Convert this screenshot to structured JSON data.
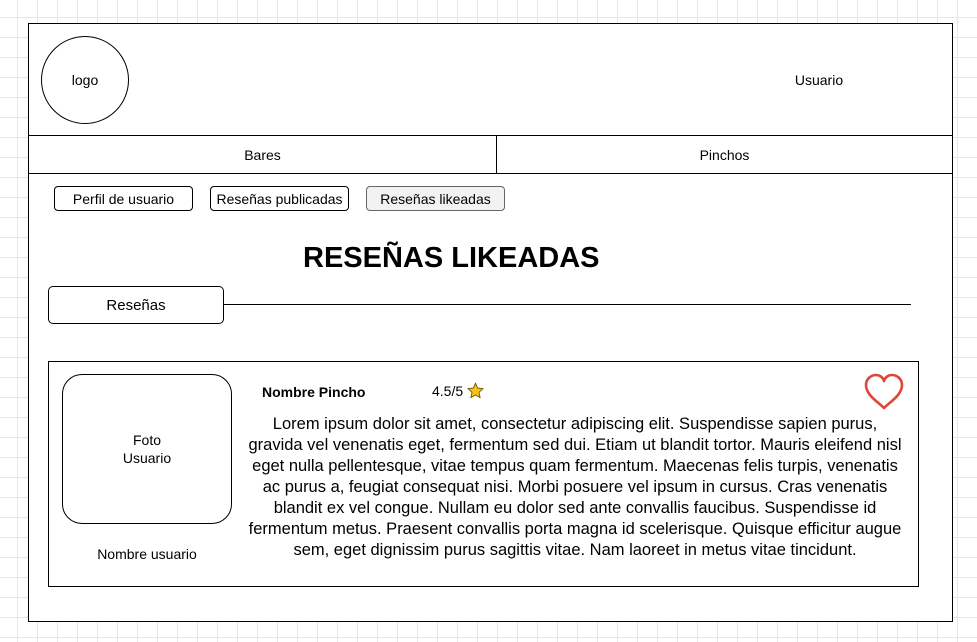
{
  "header": {
    "logo_label": "logo",
    "user_label": "Usuario"
  },
  "nav": {
    "items": [
      {
        "label": "Bares"
      },
      {
        "label": "Pinchos"
      }
    ]
  },
  "profile_tabs": [
    {
      "label": "Perfil de usuario"
    },
    {
      "label": "Reseñas publicadas"
    },
    {
      "label": "Reseñas likeadas",
      "active": true
    }
  ],
  "page": {
    "title": "RESEÑAS LIKEADAS",
    "section_tab": "Reseñas"
  },
  "review": {
    "photo_line1": "Foto",
    "photo_line2": "Usuario",
    "username": "Nombre usuario",
    "pincho_name": "Nombre Pincho",
    "rating": "4.5/5",
    "rating_icon": "star-icon",
    "like_icon": "heart-icon",
    "body": "Lorem ipsum dolor sit amet, consectetur adipiscing elit. Suspendisse sapien purus, gravida vel venenatis eget, fermentum sed dui. Etiam ut blandit tortor. Mauris eleifend nisl eget nulla pellentesque, vitae tempus quam fermentum. Maecenas felis turpis, venenatis ac purus a, feugiat consequat nisi. Morbi posuere vel ipsum in cursus. Cras venenatis blandit ex vel congue. Nullam eu dolor sed ante convallis faucibus. Suspendisse id fermentum metus. Praesent convallis porta magna id scelerisque. Quisque efficitur augue sem, eget dignissim purus sagittis vitae. Nam laoreet in metus vitae tincidunt."
  },
  "colors": {
    "heart": "#e0453a",
    "star": "#f5c518",
    "grid": "#e6e6e6"
  }
}
